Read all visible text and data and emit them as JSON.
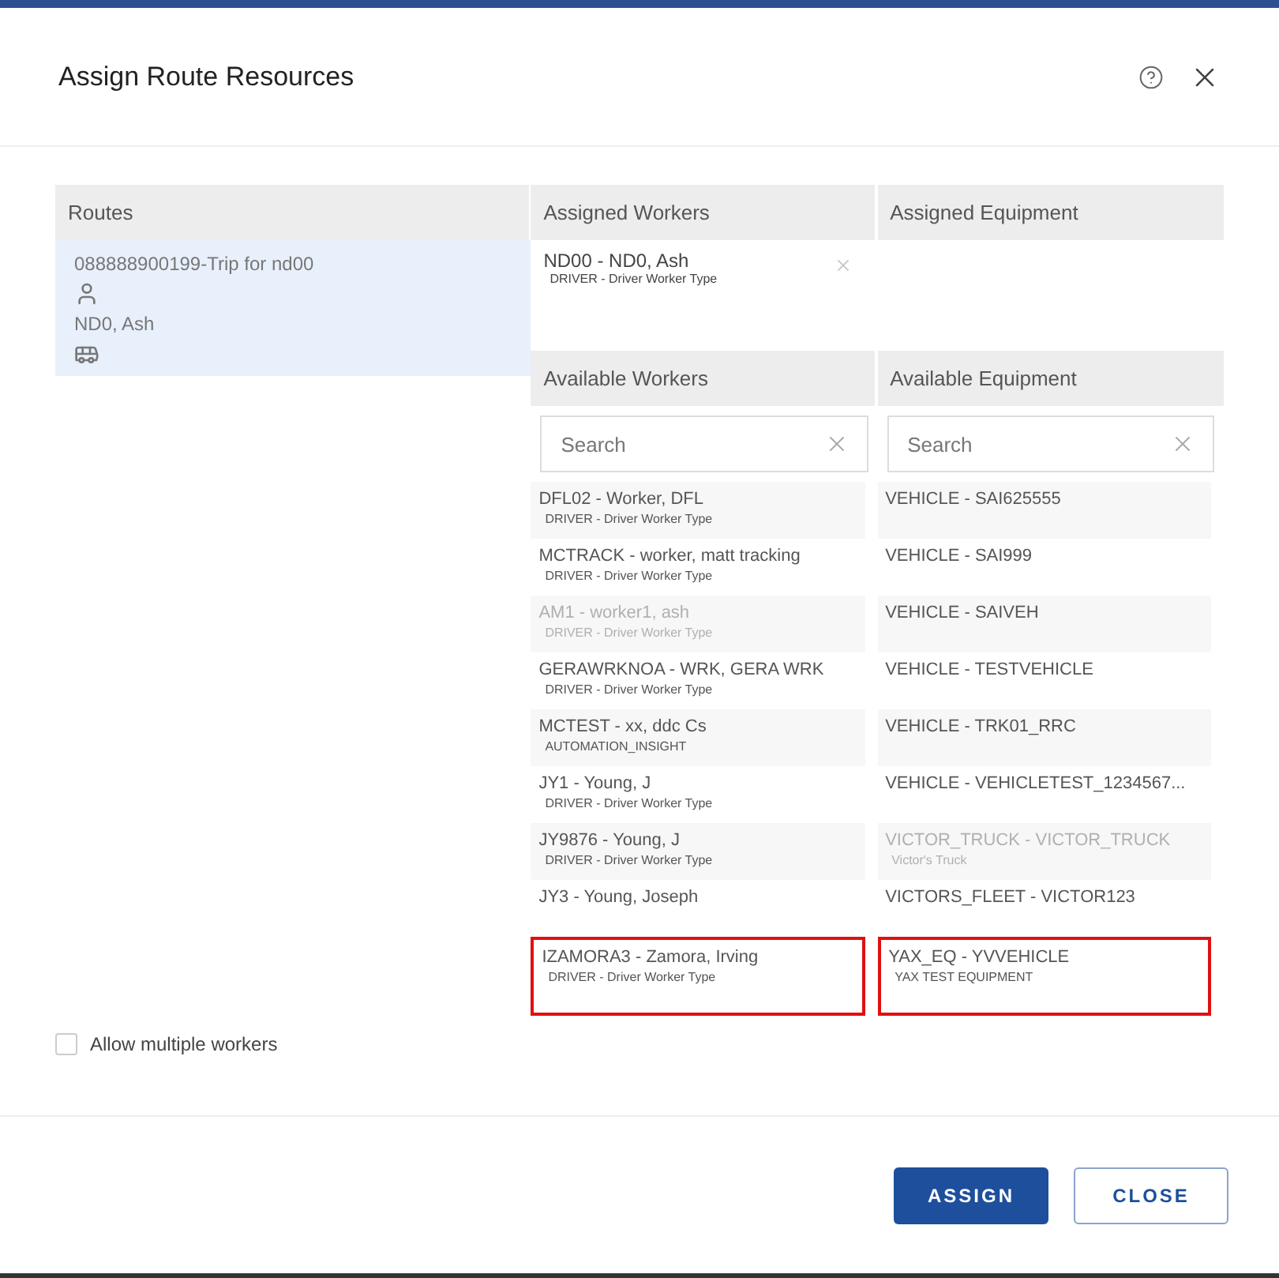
{
  "dialog": {
    "title": "Assign Route Resources"
  },
  "routes": {
    "header": "Routes",
    "items": [
      {
        "trip": "088888900199-Trip for nd00",
        "worker": "ND0, Ash",
        "selected": true
      }
    ]
  },
  "assigned_workers": {
    "header": "Assigned Workers",
    "items": [
      {
        "name": "ND00 - ND0, Ash",
        "type": "DRIVER - Driver Worker Type"
      }
    ]
  },
  "assigned_equipment": {
    "header": "Assigned Equipment"
  },
  "available_workers": {
    "header": "Available Workers",
    "search": {
      "placeholder": "Search"
    },
    "items": [
      {
        "name": "DFL02 - Worker, DFL",
        "type": "DRIVER - Driver Worker Type",
        "disabled": false,
        "highlighted": false
      },
      {
        "name": "MCTRACK - worker, matt tracking",
        "type": "DRIVER - Driver Worker Type",
        "disabled": false,
        "highlighted": false
      },
      {
        "name": "AM1 - worker1, ash",
        "type": "DRIVER - Driver Worker Type",
        "disabled": true,
        "highlighted": false
      },
      {
        "name": "GERAWRKNOA - WRK, GERA WRK",
        "type": "DRIVER - Driver Worker Type",
        "disabled": false,
        "highlighted": false
      },
      {
        "name": "MCTEST - xx, ddc Cs",
        "type": "AUTOMATION_INSIGHT",
        "disabled": false,
        "highlighted": false
      },
      {
        "name": "JY1 - Young, J",
        "type": "DRIVER - Driver Worker Type",
        "disabled": false,
        "highlighted": false
      },
      {
        "name": "JY9876 - Young, J",
        "type": "DRIVER - Driver Worker Type",
        "disabled": false,
        "highlighted": false
      },
      {
        "name": "JY3 - Young, Joseph",
        "disabled": false,
        "highlighted": false
      },
      {
        "name": "IZAMORA3 - Zamora, Irving",
        "type": "DRIVER - Driver Worker Type",
        "disabled": false,
        "highlighted": true
      }
    ]
  },
  "available_equipment": {
    "header": "Available Equipment",
    "search": {
      "placeholder": "Search"
    },
    "items": [
      {
        "name": "VEHICLE - SAI625555",
        "disabled": false,
        "highlighted": false
      },
      {
        "name": "VEHICLE - SAI999",
        "disabled": false,
        "highlighted": false
      },
      {
        "name": "VEHICLE - SAIVEH",
        "disabled": false,
        "highlighted": false
      },
      {
        "name": "VEHICLE - TESTVEHICLE",
        "disabled": false,
        "highlighted": false
      },
      {
        "name": "VEHICLE - TRK01_RRC",
        "disabled": false,
        "highlighted": false
      },
      {
        "name": "VEHICLE - VEHICLETEST_1234567...",
        "disabled": false,
        "highlighted": false
      },
      {
        "name": "VICTOR_TRUCK - VICTOR_TRUCK",
        "type": "Victor's Truck",
        "disabled": true,
        "highlighted": false
      },
      {
        "name": "VICTORS_FLEET - VICTOR123",
        "disabled": false,
        "highlighted": false
      },
      {
        "name": "YAX_EQ - YVVEHICLE",
        "type": "YAX TEST EQUIPMENT",
        "disabled": false,
        "highlighted": true
      }
    ]
  },
  "allow_multiple": {
    "label": "Allow multiple workers",
    "checked": false
  },
  "buttons": [
    {
      "label": "ASSIGN",
      "kind": "primary"
    },
    {
      "label": "CLOSE",
      "kind": "secondary"
    }
  ]
}
